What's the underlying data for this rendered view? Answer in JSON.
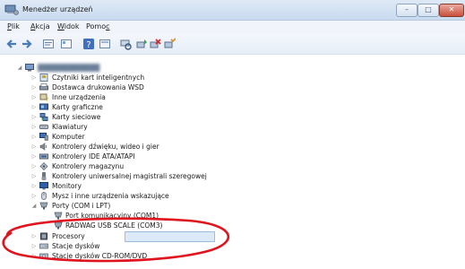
{
  "window": {
    "title": "Menedżer urządzeń",
    "buttons": {
      "minimize": "–",
      "maximize": "□",
      "close": "✕"
    }
  },
  "menu": [
    {
      "label": "Plik",
      "underline": "P",
      "rest": "lik"
    },
    {
      "label": "Akcja",
      "underline": "A",
      "rest": "kcja"
    },
    {
      "label": "Widok",
      "underline": "W",
      "rest": "idok"
    },
    {
      "label": "Pomoc",
      "pre": "Pomo",
      "underline": "c"
    }
  ],
  "toolbar": {
    "icons": [
      "back-icon",
      "forward-icon",
      "properties-icon",
      "view-icon",
      "help-icon",
      "show-hidden-icon",
      "scan-hardware-icon",
      "update-driver-icon",
      "disable-icon",
      "uninstall-icon"
    ]
  },
  "tree": {
    "root": {
      "label": "████████████",
      "expanded": true,
      "blurred": true
    },
    "items": [
      {
        "label": "Czytniki kart inteligentnych",
        "icon": "smartcard-icon"
      },
      {
        "label": "Dostawca drukowania WSD",
        "icon": "printer-icon"
      },
      {
        "label": "Inne urządzenia",
        "icon": "other-device-icon"
      },
      {
        "label": "Karty graficzne",
        "icon": "display-adapter-icon"
      },
      {
        "label": "Karty sieciowe",
        "icon": "network-adapter-icon"
      },
      {
        "label": "Klawiatury",
        "icon": "keyboard-icon"
      },
      {
        "label": "Komputer",
        "icon": "computer-icon"
      },
      {
        "label": "Kontrolery dźwięku, wideo i gier",
        "icon": "sound-icon"
      },
      {
        "label": "Kontrolery IDE ATA/ATAPI",
        "icon": "ide-controller-icon"
      },
      {
        "label": "Kontrolery magazynu",
        "icon": "storage-controller-icon"
      },
      {
        "label": "Kontrolery uniwersalnej magistrali szeregowej",
        "icon": "usb-controller-icon"
      },
      {
        "label": "Monitory",
        "icon": "monitor-icon"
      },
      {
        "label": "Mysz i inne urządzenia wskazujące",
        "icon": "mouse-icon"
      },
      {
        "label": "Porty (COM i LPT)",
        "icon": "port-icon",
        "expanded": true
      },
      {
        "label": "Port komunikacyjny (COM1)",
        "icon": "port-icon",
        "child": true
      },
      {
        "label": "RADWAG USB SCALE (COM3)",
        "icon": "port-icon",
        "child": true,
        "selected": true
      },
      {
        "label": "Procesory",
        "icon": "processor-icon"
      },
      {
        "label": "Stacje dysków",
        "icon": "disk-icon"
      },
      {
        "label": "Stacje dysków CD-ROM/DVD",
        "icon": "cdrom-icon"
      }
    ]
  },
  "colors": {
    "annotation": "#e0141e",
    "selection": "#dce9f8",
    "titlebar": "#c9dbef"
  }
}
